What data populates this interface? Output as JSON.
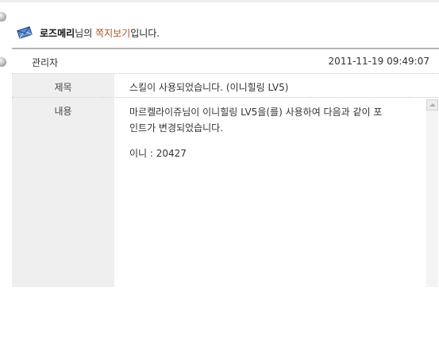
{
  "header": {
    "username": "로즈메리",
    "suffix": "님의 ",
    "title": "쪽지보기",
    "end": "입니다.",
    "icon": "envelope-icon"
  },
  "message": {
    "sender": "관리자",
    "datetime": "2011-11-19 09:49:07",
    "subject_label": "제목",
    "subject": "스킬이 사용되었습니다. (이니힐링 LV5)",
    "content_label": "내용",
    "content_lines": [
      "마르켈라이쥬님이 이니힐링 LV5을(를) 사용하여 다음과 같이 포",
      "인트가 변경되었습니다."
    ],
    "points_line": "이니 : 20427"
  },
  "colors": {
    "accent": "#b0521e",
    "label_bg": "#efefef",
    "divider": "#b4b4b4"
  }
}
